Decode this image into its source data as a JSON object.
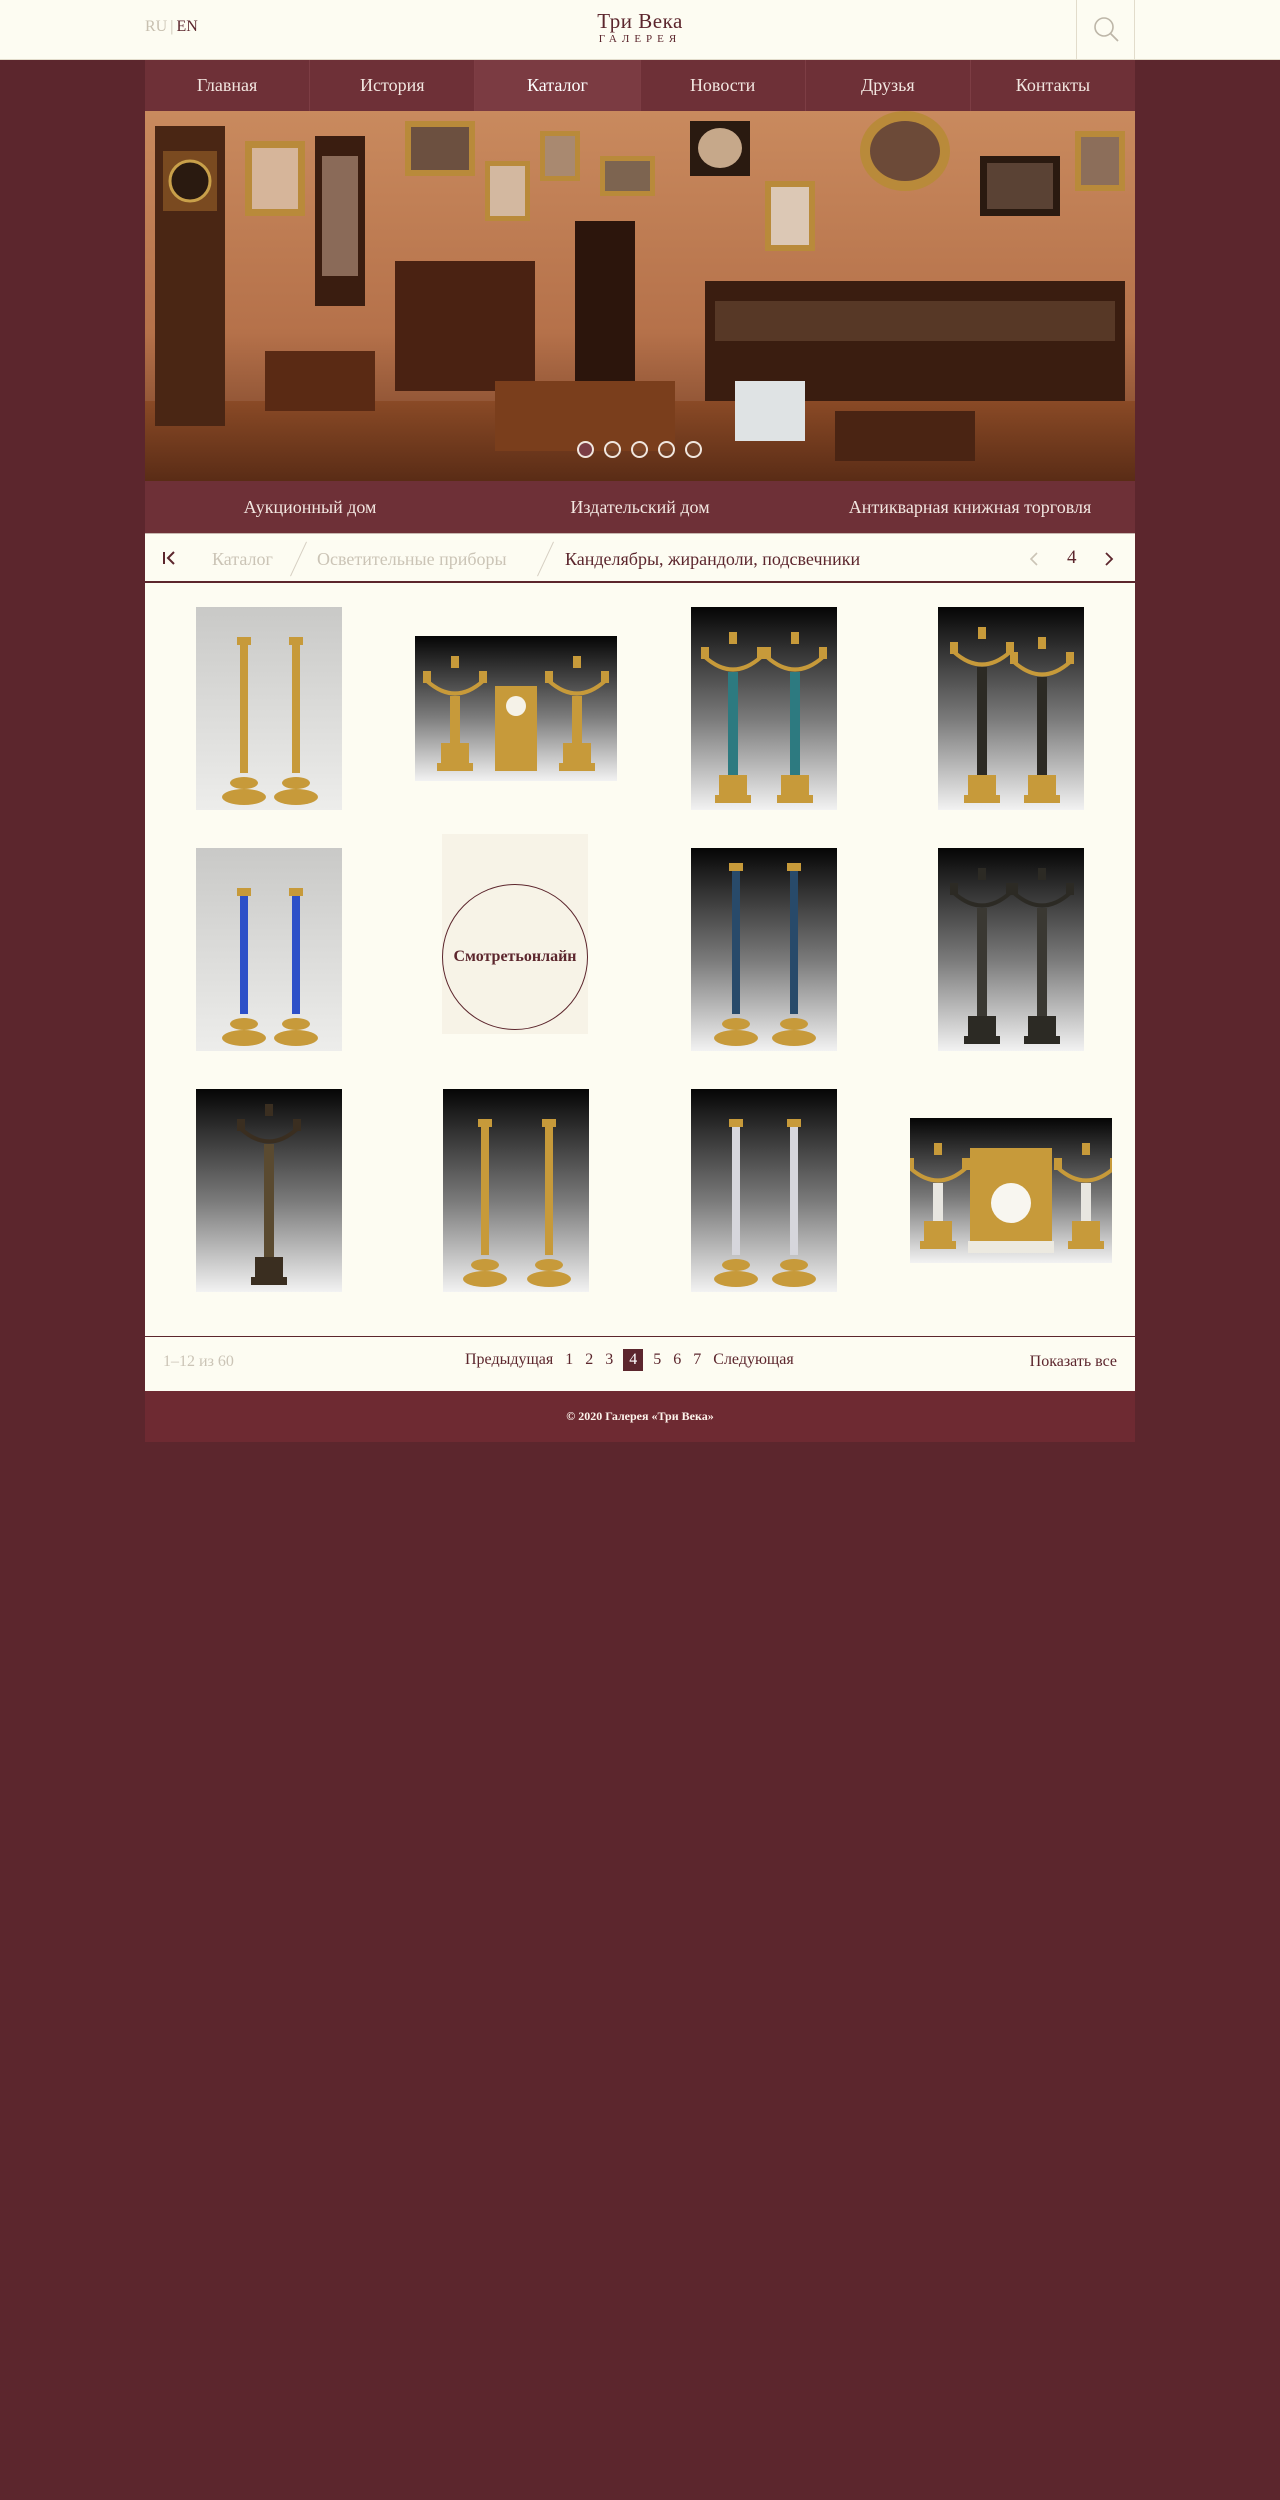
{
  "header": {
    "lang_ru": "RU",
    "lang_sep": "|",
    "lang_en": "EN",
    "logo_title": "Три Века",
    "logo_subtitle": "ГАЛЕРЕЯ",
    "search_icon": "search-icon"
  },
  "nav": {
    "items": [
      {
        "label": "Главная"
      },
      {
        "label": "История"
      },
      {
        "label": "Каталог",
        "active": true
      },
      {
        "label": "Новости"
      },
      {
        "label": "Друзья"
      },
      {
        "label": "Контакты"
      }
    ]
  },
  "hero": {
    "slide_count": 5,
    "active_slide": 1
  },
  "subnav": {
    "items": [
      {
        "label": "Аукционный дом"
      },
      {
        "label": "Издательский дом"
      },
      {
        "label": "Антикварная книжная торговля"
      }
    ]
  },
  "breadcrumb": {
    "first_icon": "first-page-icon",
    "items": [
      {
        "label": "Каталог"
      },
      {
        "label": "Осветительные приборы"
      },
      {
        "label": "Канделябры, жирандоли, подсвечники"
      }
    ],
    "page": "4",
    "prev_icon": "chevron-left-icon",
    "next_icon": "chevron-right-icon"
  },
  "catalog": {
    "online_label_line1": "Смотреть",
    "online_label_line2": "онлайн",
    "items": [
      {
        "kind": "pair-candlesticks-gilt",
        "background": "grey"
      },
      {
        "kind": "clock-garniture-gilt",
        "background": "black"
      },
      {
        "kind": "candelabra-pair-turquoise",
        "background": "black"
      },
      {
        "kind": "candelabra-pair-bronze-figures",
        "background": "black"
      },
      {
        "kind": "pair-candlesticks-blue",
        "background": "grey"
      },
      {
        "kind": "online-preview",
        "background": "cream"
      },
      {
        "kind": "candlesticks-pair-blue-panels",
        "background": "black"
      },
      {
        "kind": "candelabra-dark-figures",
        "background": "black"
      },
      {
        "kind": "candelabrum-winged-figure",
        "background": "black"
      },
      {
        "kind": "candlesticks-pair-oil-lamps",
        "background": "black"
      },
      {
        "kind": "candlesticks-pair-crystal",
        "background": "black"
      },
      {
        "kind": "clock-garniture-white",
        "background": "black"
      }
    ]
  },
  "pager": {
    "count": "1–12 из 60",
    "prev": "Предыдущая",
    "pages": [
      "1",
      "2",
      "3",
      "4",
      "5",
      "6",
      "7"
    ],
    "active_page": "4",
    "next": "Следующая",
    "show_all": "Показать все"
  },
  "footer": {
    "copyright": "© 2020 Галерея «Три Века»"
  },
  "colors": {
    "brand": "#5c262d",
    "background": "#fdfcf2",
    "nav": "#6e3037"
  }
}
